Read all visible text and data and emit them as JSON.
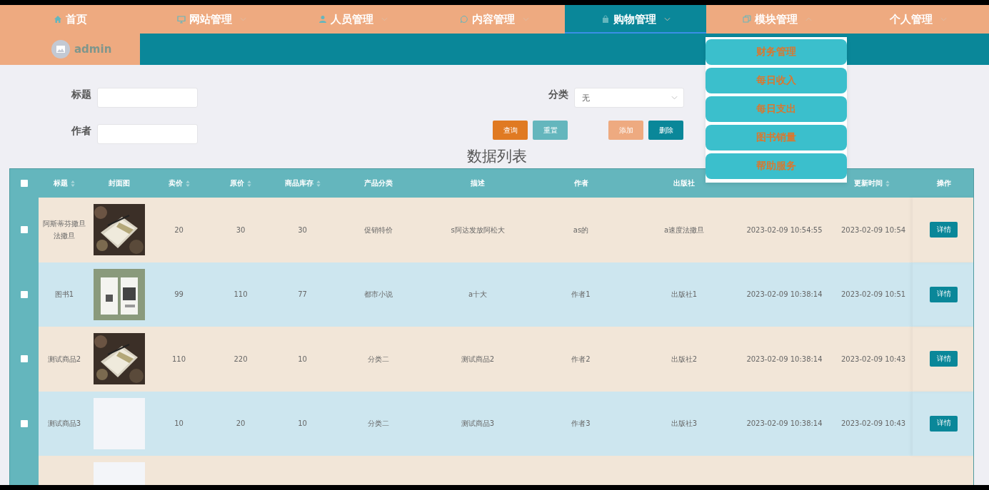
{
  "nav": [
    {
      "label": "首页",
      "kind": "home",
      "selected": false
    },
    {
      "label": "网站管理",
      "kind": "monitor",
      "expanded": false,
      "selected": false
    },
    {
      "label": "人员管理",
      "kind": "person",
      "expanded": false,
      "selected": false
    },
    {
      "label": "内容管理",
      "kind": "chat",
      "expanded": false,
      "selected": false
    },
    {
      "label": "购物管理",
      "kind": "bag",
      "expanded": false,
      "selected": true
    },
    {
      "label": "模块管理",
      "kind": "copy",
      "expanded": true,
      "selected": false
    },
    {
      "label": "个人管理",
      "kind": "plain",
      "expanded": false,
      "selected": false
    }
  ],
  "user": {
    "name": "admin"
  },
  "dropdown": [
    "财务管理",
    "每日收入",
    "每日支出",
    "图书销量",
    "帮助服务"
  ],
  "search": {
    "fields": [
      {
        "label": "标题"
      },
      {
        "label": "作者"
      }
    ],
    "category": {
      "label": "分类",
      "value": "无"
    }
  },
  "buttons": [
    {
      "label": "查询",
      "kind": "query"
    },
    {
      "label": "重置",
      "kind": "reset"
    },
    {
      "label": "添加",
      "kind": "add"
    },
    {
      "label": "删除",
      "kind": "delete"
    }
  ],
  "table": {
    "title": "数据列表",
    "all_checked": false,
    "columns": [
      {
        "label": "标题",
        "sortable": true
      },
      {
        "label": "封面图",
        "sortable": false
      },
      {
        "label": "卖价",
        "sortable": true
      },
      {
        "label": "原价",
        "sortable": true
      },
      {
        "label": "商品库存",
        "sortable": true
      },
      {
        "label": "产品分类",
        "sortable": false
      },
      {
        "label": "描述",
        "sortable": false
      },
      {
        "label": "作者",
        "sortable": false
      },
      {
        "label": "出版社",
        "sortable": false
      },
      {
        "sortable": false
      },
      {
        "label": "更新时间",
        "sortable": true
      },
      {
        "label": "操作",
        "sortable": false
      }
    ],
    "rows": [
      {
        "checked": false,
        "cells": [
          "阿斯蒂芬撒旦法撒旦",
          {
            "kind": "picture"
          },
          "20",
          "30",
          "30",
          "促销特价",
          "s阿达发放阿松大",
          "as的",
          "a速度法撒旦",
          "2023-02-09 10:54:55",
          "2023-02-09 10:54",
          "详情"
        ]
      },
      {
        "checked": false,
        "cells": [
          "图书1",
          {
            "kind": "picture"
          },
          "99",
          "110",
          "77",
          "都市小说",
          "a十大",
          "作者1",
          "出版社1",
          "2023-02-09 10:38:14",
          "2023-02-09 10:51",
          "详情"
        ]
      },
      {
        "checked": false,
        "cells": [
          "测试商品2",
          {
            "kind": "picture"
          },
          "110",
          "220",
          "10",
          "分类二",
          "测试商品2",
          "作者2",
          "出版社2",
          "2023-02-09 10:38:14",
          "2023-02-09 10:43",
          "详情"
        ]
      },
      {
        "checked": false,
        "cells": [
          "测试商品3",
          {
            "kind": "blank"
          },
          "10",
          "20",
          "10",
          "分类二",
          "测试商品3",
          "作者3",
          "出版社3",
          "2023-02-09 10:38:14",
          "2023-02-09 10:43",
          "详情"
        ]
      }
    ]
  }
}
